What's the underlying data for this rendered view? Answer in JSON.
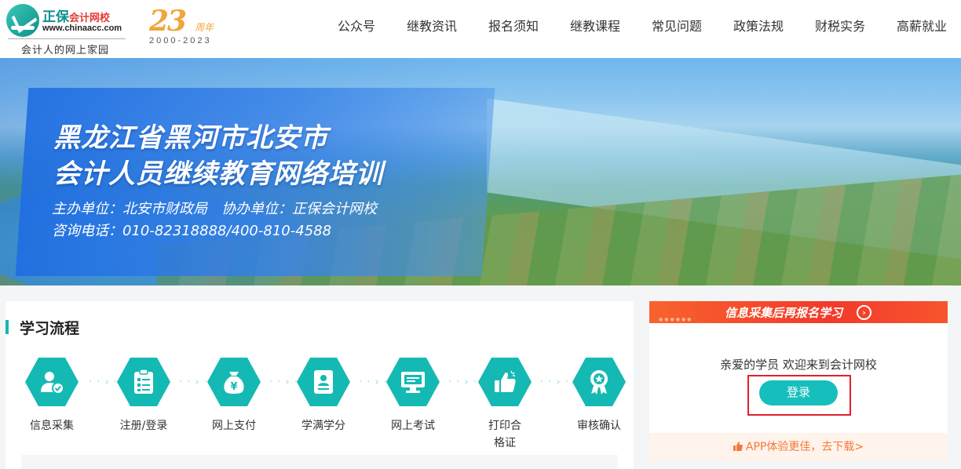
{
  "header": {
    "logo": {
      "name_part1": "正保",
      "name_part2": "会计网校",
      "url": "www.chinaacc.com",
      "slogan": "会计人的网上家园"
    },
    "anniversary": {
      "number": "23",
      "unit": "周年",
      "years": "2000-2023",
      "color": "#f0a63a"
    },
    "nav": [
      {
        "label": "公众号"
      },
      {
        "label": "继教资讯"
      },
      {
        "label": "报名须知"
      },
      {
        "label": "继教课程"
      },
      {
        "label": "常见问题"
      },
      {
        "label": "政策法规"
      },
      {
        "label": "财税实务"
      },
      {
        "label": "高薪就业"
      }
    ]
  },
  "banner": {
    "title_line1": "黑龙江省黑河市北安市",
    "title_line2": "会计人员继续教育网络培训",
    "host": "主办单位：北安市财政局",
    "co_host": "协办单位：正保会计网校",
    "phone": "咨询电话：010-82318888/400-810-4588"
  },
  "study_flow": {
    "title": "学习流程",
    "accent_color": "#15b9b4",
    "steps": [
      {
        "label": "信息采集",
        "icon": "user-check-icon"
      },
      {
        "label": "注册/登录",
        "icon": "clipboard-list-icon"
      },
      {
        "label": "网上支付",
        "icon": "money-bag-icon"
      },
      {
        "label": "学满学分",
        "icon": "profile-card-icon"
      },
      {
        "label": "网上考试",
        "icon": "monitor-icon"
      },
      {
        "label": "打印合格证",
        "icon": "thumbs-up-icon"
      },
      {
        "label": "审核确认",
        "icon": "award-medal-icon"
      }
    ],
    "arrow": "· · › ·"
  },
  "login_panel": {
    "banner_text": "信息采集后再报名学习",
    "banner_icon": "chevron-right-circle-icon",
    "banner_colors": [
      "#f8632e",
      "#f23a2a"
    ],
    "welcome": "亲爱的学员 欢迎来到会计网校",
    "login_label": "登录",
    "login_color": "#16bfbc",
    "app_text": "APP体验更佳，去下载>",
    "app_color": "#f4793a"
  }
}
